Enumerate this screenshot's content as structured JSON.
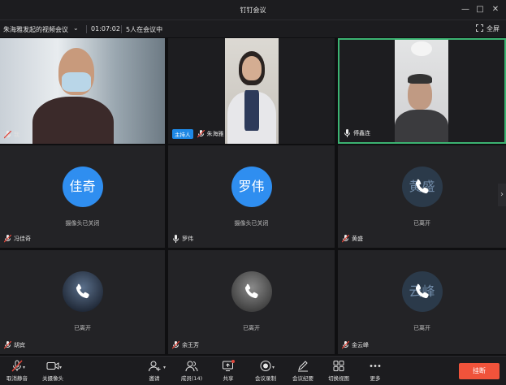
{
  "window": {
    "title": "钉钉会议",
    "min": "—",
    "max": "□",
    "close": "✕"
  },
  "infobar": {
    "meeting_name": "朱海雅发起的视频会议",
    "duration": "01:07:02",
    "participants_status": "5人在会议中",
    "fullscreen_label": "全屏"
  },
  "tiles": [
    {
      "name": "我",
      "mic": "muted"
    },
    {
      "name": "朱海雅",
      "badge": "主持人",
      "mic": "muted"
    },
    {
      "name": "傅鑫连",
      "mic": "on",
      "active": true
    },
    {
      "name": "冯佳奇",
      "avatar_text": "佳奇",
      "status": "摄像头已关闭",
      "mic": "muted"
    },
    {
      "name": "罗伟",
      "avatar_text": "罗伟",
      "status": "摄像头已关闭",
      "mic": "on"
    },
    {
      "name": "黄盛",
      "avatar_text": "黄盛",
      "status": "已离开",
      "mic": "muted"
    },
    {
      "name": "胡宾",
      "status": "已离开",
      "mic": "muted"
    },
    {
      "name": "余王芳",
      "status": "已离开",
      "mic": "muted"
    },
    {
      "name": "金云峰",
      "avatar_text": "云峰",
      "status": "已离开",
      "mic": "muted"
    }
  ],
  "toolbar": {
    "unmute": "取消静音",
    "camera": "关摄像头",
    "invite": "邀请",
    "members": "成员(14)",
    "share": "共享",
    "record": "会议录制",
    "minutes": "会议纪要",
    "switch_view": "切换视图",
    "more": "更多",
    "end": "挂断"
  },
  "colors": {
    "accent": "#2f8ef0",
    "active_border": "#3cb372",
    "end": "#f0533b",
    "muted": "#e0463a"
  }
}
